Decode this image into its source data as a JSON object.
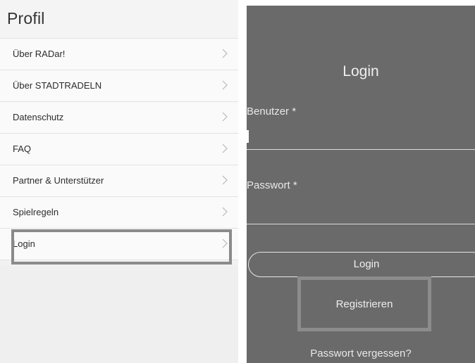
{
  "profil": {
    "title": "Profil",
    "items": [
      {
        "label": "Über RADar!"
      },
      {
        "label": "Über STADTRADELN"
      },
      {
        "label": "Datenschutz"
      },
      {
        "label": "FAQ"
      },
      {
        "label": "Partner & Unterstützer"
      },
      {
        "label": "Spielregeln"
      },
      {
        "label": "Login"
      }
    ]
  },
  "login": {
    "title": "Login",
    "username_label": "Benutzer *",
    "username_value": "",
    "password_label": "Passwort *",
    "password_value": "",
    "login_button": "Login",
    "register_link": "Registrieren",
    "forgot_link": "Passwort vergessen?"
  },
  "colors": {
    "left_bg": "#f1f1f1",
    "right_bg": "#6a6a6a",
    "highlight": "#8a8a8a"
  },
  "icons": {
    "menu_chevron": "chevron-right-icon"
  }
}
